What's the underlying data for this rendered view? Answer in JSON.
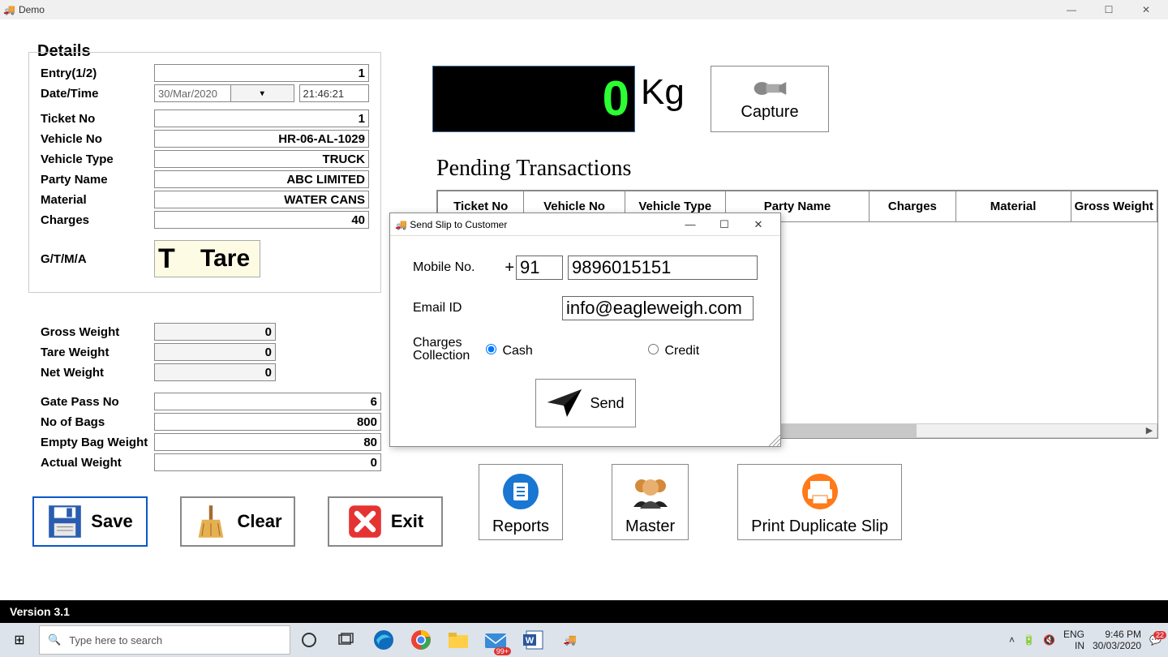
{
  "window": {
    "title": "Demo"
  },
  "details": {
    "legend": "Details",
    "entry_label": "Entry(1/2)",
    "entry": "1",
    "datetime_label": "Date/Time",
    "date": "30/Mar/2020",
    "time": "21:46:21",
    "ticket_label": "Ticket No",
    "ticket": "1",
    "vehicle_no_label": "Vehicle No",
    "vehicle_no": "HR-06-AL-1029",
    "vehicle_type_label": "Vehicle Type",
    "vehicle_type": "TRUCK",
    "party_label": "Party Name",
    "party": "ABC LIMITED",
    "material_label": "Material",
    "material": "WATER CANS",
    "charges_label": "Charges",
    "charges": "40",
    "gtma_label": "G/T/M/A",
    "tare_t": "T",
    "tare_text": "Tare",
    "gross_label": "Gross Weight",
    "gross": "0",
    "tare_label": "Tare Weight",
    "tare": "0",
    "net_label": "Net Weight",
    "net": "0"
  },
  "extra": {
    "gatepass_label": "Gate Pass No",
    "gatepass": "6",
    "bags_label": "No of Bags",
    "bags": "800",
    "emptybag_label": "Empty Bag Weight",
    "emptybag": "80",
    "actual_label": "Actual Weight",
    "actual": "0"
  },
  "weight_display": {
    "value": "0",
    "unit": "Kg",
    "capture": "Capture"
  },
  "pending": {
    "title": "Pending Transactions",
    "cols": [
      "Ticket No",
      "Vehicle No",
      "Vehicle Type",
      "Party Name",
      "Charges",
      "Material",
      "Gross Weight"
    ]
  },
  "actions": {
    "save": "Save",
    "clear": "Clear",
    "exit": "Exit"
  },
  "nav": {
    "reports": "Reports",
    "master": "Master",
    "printdup": "Print Duplicate Slip"
  },
  "modal": {
    "title": "Send Slip to Customer",
    "mobile_label": "Mobile No.",
    "plus": "+",
    "cc": "91",
    "mobile": "9896015151",
    "email_label": "Email ID",
    "email": "info@eagleweigh.com",
    "charges_label": "Charges Collection",
    "cash": "Cash",
    "credit": "Credit",
    "send": "Send"
  },
  "footer": {
    "version": "Version 3.1"
  },
  "taskbar": {
    "search_placeholder": "Type here to search",
    "lang1": "ENG",
    "lang2": "IN",
    "time": "9:46 PM",
    "date": "30/03/2020",
    "badge": "99+",
    "notif": "22"
  }
}
